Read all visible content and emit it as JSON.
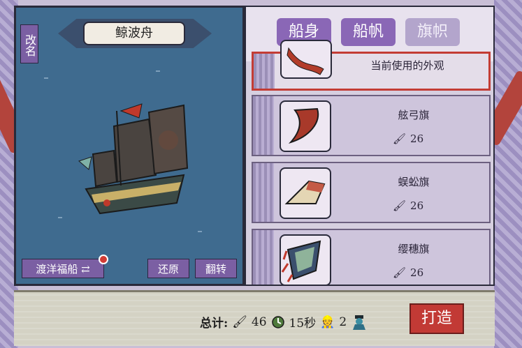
{
  "ship_panel": {
    "rename_label": "改名",
    "ship_name": "鲸波舟",
    "ship_type_label": "渡洋福船",
    "reset_label": "还原",
    "flip_label": "翻转"
  },
  "tabs": [
    {
      "label": "船身",
      "active": true
    },
    {
      "label": "船帆",
      "active": true
    },
    {
      "label": "旗帜",
      "active": false
    }
  ],
  "flags": [
    {
      "title": "当前使用的外观",
      "current": true
    },
    {
      "title": "舷弓旗",
      "cost": "26",
      "cost_icon": "ink-brush-icon"
    },
    {
      "title": "蜈蚣旗",
      "cost": "26",
      "cost_icon": "ink-brush-icon"
    },
    {
      "title": "缨穗旗",
      "cost": "26",
      "cost_icon": "ink-brush-icon"
    }
  ],
  "footer": {
    "total_label": "总计:",
    "brush_total": "46",
    "time_total": "15秒",
    "worker_count": "2",
    "build_label": "打造"
  },
  "colors": {
    "accent_purple": "#8a67b6",
    "build_red": "#c23a35",
    "sea_blue": "#3f6b8f"
  }
}
